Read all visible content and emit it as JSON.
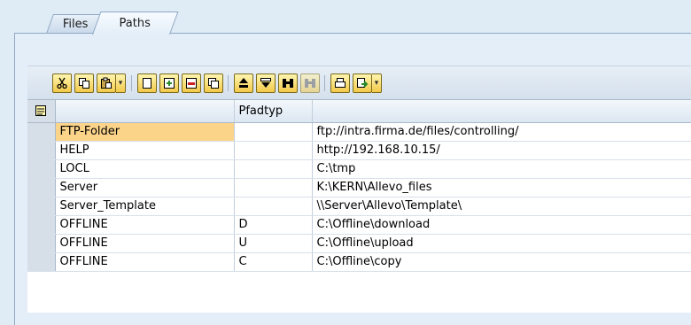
{
  "tabs": [
    {
      "label": "Files",
      "active": false
    },
    {
      "label": "Paths",
      "active": true
    }
  ],
  "toolbar": {
    "buttons": [
      "cut-icon",
      "copy-icon",
      "paste-icon",
      "new-row-icon",
      "insert-row-icon",
      "delete-row-icon",
      "duplicate-row-icon",
      "sort-icon",
      "filter-icon",
      "find-icon",
      "find-next-icon",
      "print-icon",
      "export-icon"
    ]
  },
  "table": {
    "headers": [
      "",
      "Pfadtyp",
      ""
    ],
    "rows": [
      {
        "name": "FTP-Folder",
        "type": "",
        "path": "ftp://intra.firma.de/files/controlling/"
      },
      {
        "name": "HELP",
        "type": "",
        "path": "http://192.168.10.15/"
      },
      {
        "name": "LOCL",
        "type": "",
        "path": "C:\\tmp"
      },
      {
        "name": "Server",
        "type": "",
        "path": "K:\\KERN\\Allevo_files"
      },
      {
        "name": "Server_Template",
        "type": "",
        "path": "\\\\Server\\Allevo\\Template\\"
      },
      {
        "name": "OFFLINE",
        "type": "D",
        "path": "C:\\Offline\\download"
      },
      {
        "name": "OFFLINE",
        "type": "U",
        "path": "C:\\Offline\\upload"
      },
      {
        "name": "OFFLINE",
        "type": "C",
        "path": "C:\\Offline\\copy"
      }
    ]
  },
  "colors": {
    "highlight": "#fbd48a",
    "button": "#f2c94a",
    "background": "#dfebf5"
  }
}
